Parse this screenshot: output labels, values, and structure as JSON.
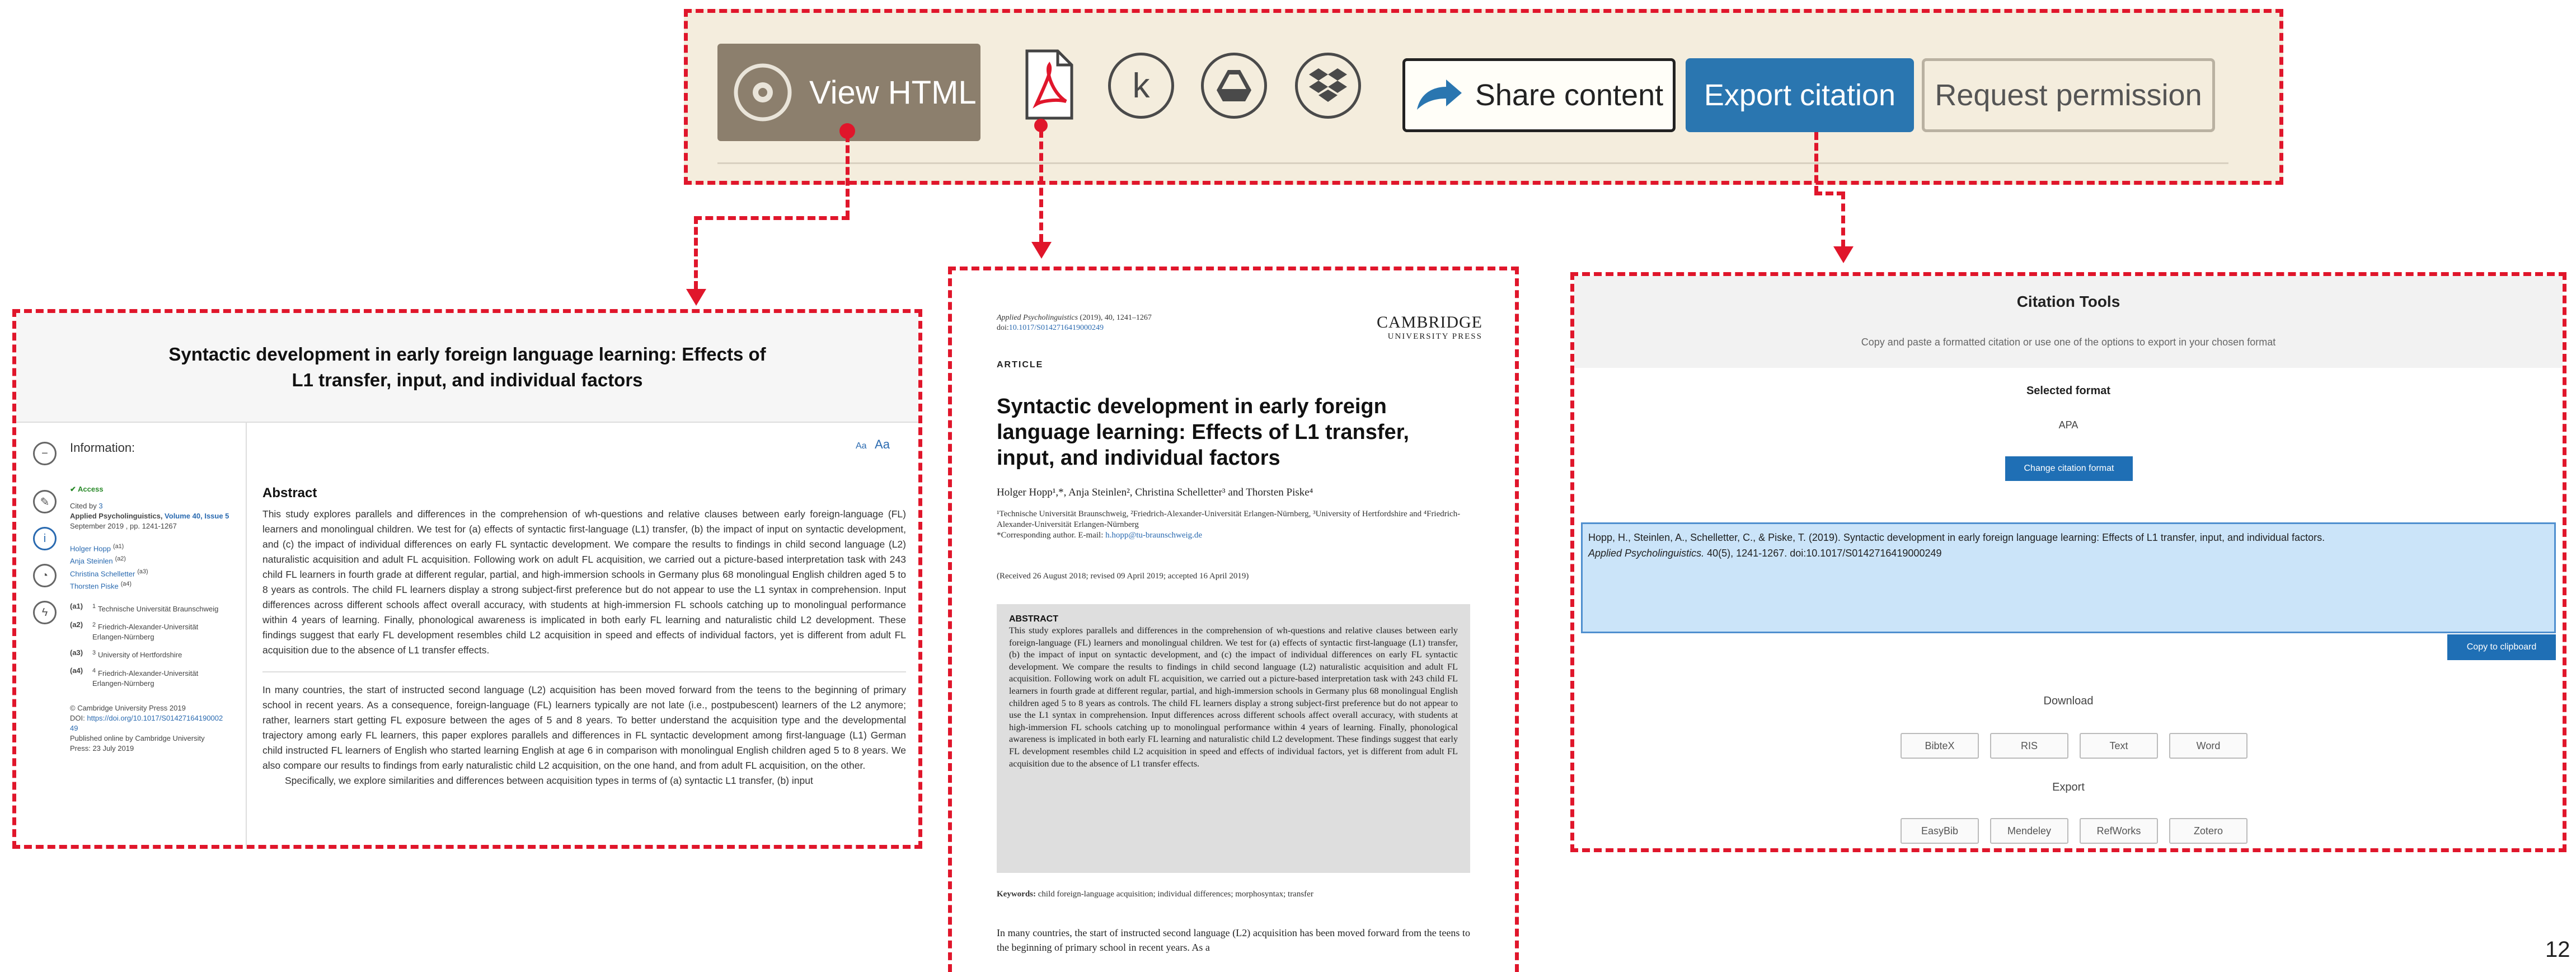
{
  "toolbar": {
    "view_html": "View HTML",
    "icons": [
      "eye-icon",
      "pdf-icon",
      "kindle-icon",
      "google-drive-icon",
      "dropbox-icon",
      "share-arrow-icon"
    ],
    "kindle_glyph": "k",
    "share": "Share content",
    "export": "Export citation",
    "request": "Request permission"
  },
  "html_view": {
    "title": "Syntactic development in early foreign language learning: Effects of L1 transfer, input, and individual factors",
    "info_label": "Information:",
    "access": "✔ Access",
    "cited_by": "Cited by",
    "cited_count": "3",
    "journal": "Applied Psycholinguistics",
    "volume": "Volume 40, Issue 5",
    "issue_line": "September 2019 , pp. 1241-1267",
    "authors": [
      {
        "name": "Holger Hopp",
        "sup": "(a1)"
      },
      {
        "name": "Anja Steinlen",
        "sup": "(a2)"
      },
      {
        "name": "Christina Schelletter",
        "sup": "(a3)"
      },
      {
        "name": "Thorsten Piske",
        "sup": "(a4)"
      }
    ],
    "affiliations": [
      {
        "key": "(a1)",
        "sup": "1",
        "text": "Technische Universität Braunschweig"
      },
      {
        "key": "(a2)",
        "sup": "2",
        "text": "Friedrich-Alexander-Universität Erlangen-Nürnberg"
      },
      {
        "key": "(a3)",
        "sup": "3",
        "text": "University of Hertfordshire"
      },
      {
        "key": "(a4)",
        "sup": "4",
        "text": "Friedrich-Alexander-Universität Erlangen-Nürnberg"
      }
    ],
    "copyright": "© Cambridge University Press 2019",
    "doi_label": "DOI:",
    "doi": "https://doi.org/10.1017/S0142716419000249",
    "published": "Published online by Cambridge University Press: 23 July 2019",
    "font_small": "Aa",
    "font_large": "Aa",
    "abstract_heading": "Abstract",
    "abstract": "This study explores parallels and differences in the comprehension of wh-questions and relative clauses between early foreign-language (FL) learners and monolingual children. We test for (a) effects of syntactic first-language (L1) transfer, (b) the impact of input on syntactic development, and (c) the impact of individual differences on early FL syntactic development. We compare the results to findings in child second language (L2) naturalistic acquisition and adult FL acquisition. Following work on adult FL acquisition, we carried out a picture-based interpretation task with 243 child FL learners in fourth grade at different regular, partial, and high-immersion schools in Germany plus 68 monolingual English children aged 5 to 8 years as controls. The child FL learners display a strong subject-first preference but do not appear to use the L1 syntax in comprehension. Input differences across different schools affect overall accuracy, with students at high-immersion FL schools catching up to monolingual performance within 4 years of learning. Finally, phonological awareness is implicated in both early FL learning and naturalistic child L2 development. These findings suggest that early FL development resembles child L2 acquisition in speed and effects of individual factors, yet is different from adult FL acquisition due to the absence of L1 transfer effects.",
    "intro": "In many countries, the start of instructed second language (L2) acquisition has been moved forward from the teens to the beginning of primary school in recent years. As a consequence, foreign-language (FL) learners typically are not late (i.e., postpubescent) learners of the L2 anymore; rather, learners start getting FL exposure between the ages of 5 and 8 years. To better understand the acquisition type and the developmental trajectory among early FL learners, this paper explores parallels and differences in FL syntactic development among first-language (L1) German child instructed FL learners of English who started learning English at age 6 in comparison with monolingual English children aged 5 to 8 years. We also compare our results to findings from early naturalistic child L2 acquisition, on the one hand, and from adult FL acquisition, on the other.",
    "intro2": "Specifically, we explore similarities and differences between acquisition types in terms of (a) syntactic L1 transfer, (b) input"
  },
  "pdf_view": {
    "journal_line": "Applied Psycholinguistics",
    "journal_rest": " (2019), 40, 1241–1267",
    "doi_prefix": "doi:",
    "doi": "10.1017/S0142716419000249",
    "publisher_1": "CAMBRIDGE",
    "publisher_2": "UNIVERSITY PRESS",
    "label": "ARTICLE",
    "title": "Syntactic development in early foreign language learning: Effects of L1 transfer, input, and individual factors",
    "authors": "Holger Hopp¹,*, Anja Steinlen², Christina Schelletter³ and Thorsten Piske⁴",
    "affil": "¹Technische Universität Braunschweig, ²Friedrich-Alexander-Universität Erlangen-Nürnberg, ³University of Hertfordshire and ⁴Friedrich-Alexander-Universität Erlangen-Nürnberg",
    "corr_label": "*Corresponding author. E-mail: ",
    "corr_email": "h.hopp@tu-braunschweig.de",
    "received": "(Received 26 August 2018; revised 09 April 2019; accepted 16 April 2019)",
    "abstract_heading": "ABSTRACT",
    "abstract": "This study explores parallels and differences in the comprehension of wh-questions and relative clauses between early foreign-language (FL) learners and monolingual children. We test for (a) effects of syntactic first-language (L1) transfer, (b) the impact of input on syntactic development, and (c) the impact of individual differences on early FL syntactic development. We compare the results to findings in child second language (L2) naturalistic acquisition and adult FL acquisition. Following work on adult FL acquisition, we carried out a picture-based interpretation task with 243 child FL learners in fourth grade at different regular, partial, and high-immersion schools in Germany plus 68 monolingual English children aged 5 to 8 years as controls. The child FL learners display a strong subject-first preference but do not appear to use the L1 syntax in comprehension. Input differences across different schools affect overall accuracy, with students at high-immersion FL schools catching up to monolingual performance within 4 years of learning. Finally, phonological awareness is implicated in both early FL learning and naturalistic child L2 development. These findings suggest that early FL development resembles child L2 acquisition in speed and effects of individual factors, yet is different from adult FL acquisition due to the absence of L1 transfer effects.",
    "keywords_label": "Keywords:",
    "keywords": " child foreign-language acquisition; individual differences; morphosyntax; transfer",
    "intro": "In many countries, the start of instructed second language (L2) acquisition has been moved forward from the teens to the beginning of primary school in recent years. As a"
  },
  "citation": {
    "title": "Citation Tools",
    "subtitle": "Copy and paste a formatted citation or use one of the options to export in your chosen format",
    "selected_label": "Selected format",
    "selected": "APA",
    "change_btn": "Change citation format",
    "citation_text": "Hopp, H., Steinlen, A., Schelletter, C., & Piske, T. (2019). Syntactic development in early foreign language learning: Effects of L1 transfer, input, and individual factors.",
    "citation_journal": "Applied Psycholinguistics.",
    "citation_rest": " 40(5), 1241-1267. doi:10.1017/S0142716419000249",
    "copy_btn": "Copy to clipboard",
    "download_label": "Download",
    "download": [
      "BibteX",
      "RIS",
      "Text",
      "Word"
    ],
    "export_label": "Export",
    "export": [
      "EasyBib",
      "Mendeley",
      "RefWorks",
      "Zotero"
    ]
  },
  "page_number": "12",
  "colors": {
    "annotation": "#e0162b",
    "export_blue": "#2a76b0",
    "toolbar_bg": "#f4eddd"
  }
}
